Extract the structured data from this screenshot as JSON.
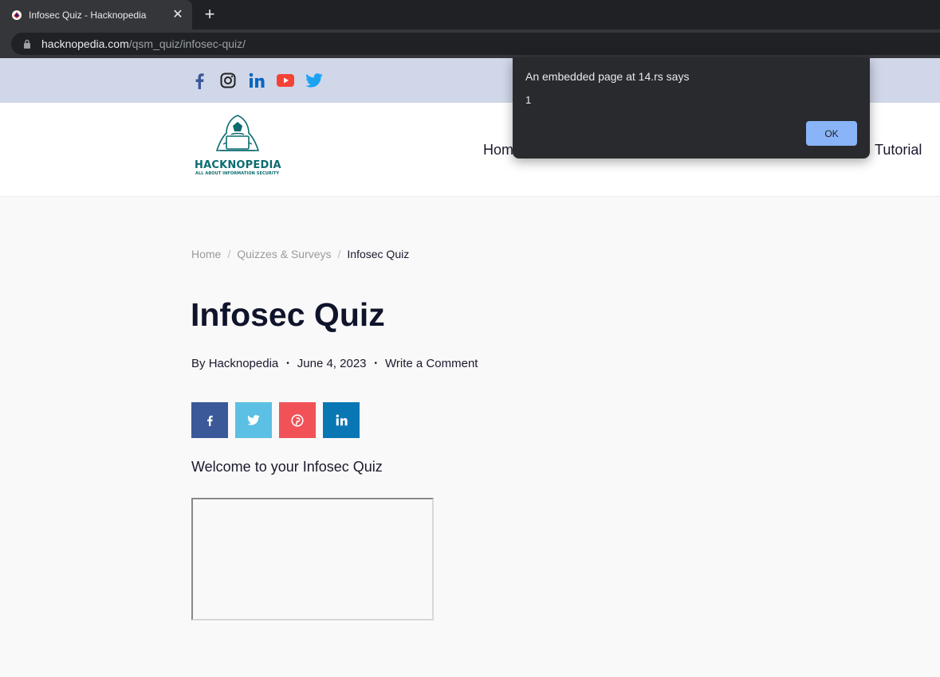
{
  "browser": {
    "tab_title": "Infosec Quiz - Hacknopedia",
    "url_host": "hacknopedia.com",
    "url_path": "/qsm_quiz/infosec-quiz/"
  },
  "social_icons": [
    "facebook-icon",
    "instagram-icon",
    "linkedin-icon",
    "youtube-icon",
    "twitter-icon"
  ],
  "logo": {
    "name": "HACKNOPEDIA",
    "tagline": "ALL ABOUT INFORMATION SECURITY"
  },
  "nav": {
    "home": "Home",
    "tutorial": "Tutorial"
  },
  "breadcrumb": {
    "home": "Home",
    "category": "Quizzes & Surveys",
    "current": "Infosec Quiz"
  },
  "post": {
    "title": "Infosec Quiz",
    "by_label": "By",
    "author": "Hacknopedia",
    "date": "June 4, 2023",
    "comment_link": "Write a Comment",
    "welcome": "Welcome to your Infosec Quiz"
  },
  "share_buttons": [
    {
      "name": "facebook",
      "color": "#3b5998"
    },
    {
      "name": "twitter",
      "color": "#5bc0e3"
    },
    {
      "name": "pinterest",
      "color": "#f05258"
    },
    {
      "name": "linkedin",
      "color": "#0a77b5"
    }
  ],
  "dialog": {
    "title": "An embedded page at 14.rs says",
    "message": "1",
    "ok_label": "OK"
  },
  "colors": {
    "brand": "#0c6b70",
    "top_strip": "#d0d7e9"
  }
}
